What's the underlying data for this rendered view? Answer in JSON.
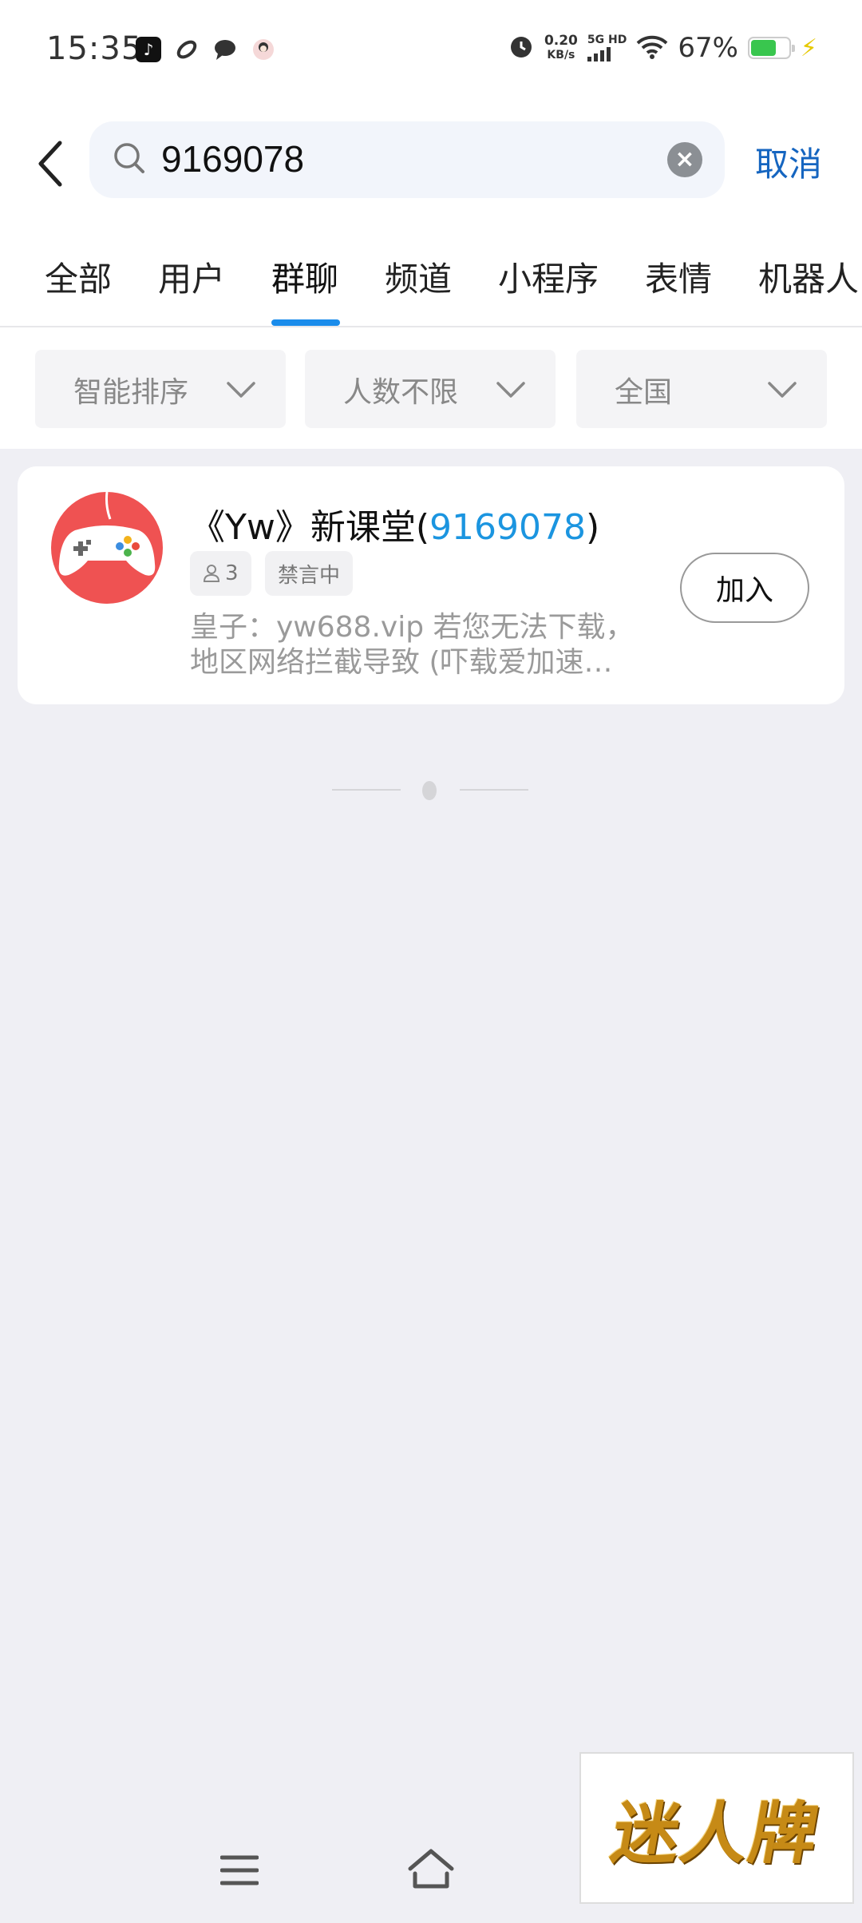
{
  "status_bar": {
    "time": "15:35",
    "net_speed_value": "0.20",
    "net_speed_unit": "KB/s",
    "signal_label": "5G HD",
    "battery_percent_text": "67%",
    "battery_level": 0.67,
    "icons": [
      "tiktok-icon",
      "link-icon",
      "chat-icon",
      "avatar-icon",
      "alarm-icon",
      "wifi-icon",
      "battery-icon",
      "charging-icon"
    ]
  },
  "search": {
    "query": "9169078",
    "cancel_label": "取消"
  },
  "tabs": [
    {
      "label": "全部"
    },
    {
      "label": "用户"
    },
    {
      "label": "群聊",
      "active": true
    },
    {
      "label": "频道"
    },
    {
      "label": "小程序"
    },
    {
      "label": "表情"
    },
    {
      "label": "机器人"
    }
  ],
  "filters": [
    {
      "label": "智能排序"
    },
    {
      "label": "人数不限"
    },
    {
      "label": "全国"
    }
  ],
  "result": {
    "name_prefix": "《Yw》新课堂(",
    "name_highlight": "9169078",
    "name_suffix": ")",
    "member_count": "3",
    "status_tag": "禁言中",
    "desc_line1": "皇子：yw688.vip   若您无法下载，",
    "desc_line2": "地区网络拦截导致 (吓载爱加速…",
    "join_label": "加入"
  },
  "watermark": {
    "text": "迷人牌"
  },
  "colors": {
    "accent_blue": "#1a8ceb",
    "cancel_blue": "#1565c0",
    "highlight_blue": "#1b95e0",
    "avatar_red": "#ef5252",
    "background": "#efeff4"
  }
}
